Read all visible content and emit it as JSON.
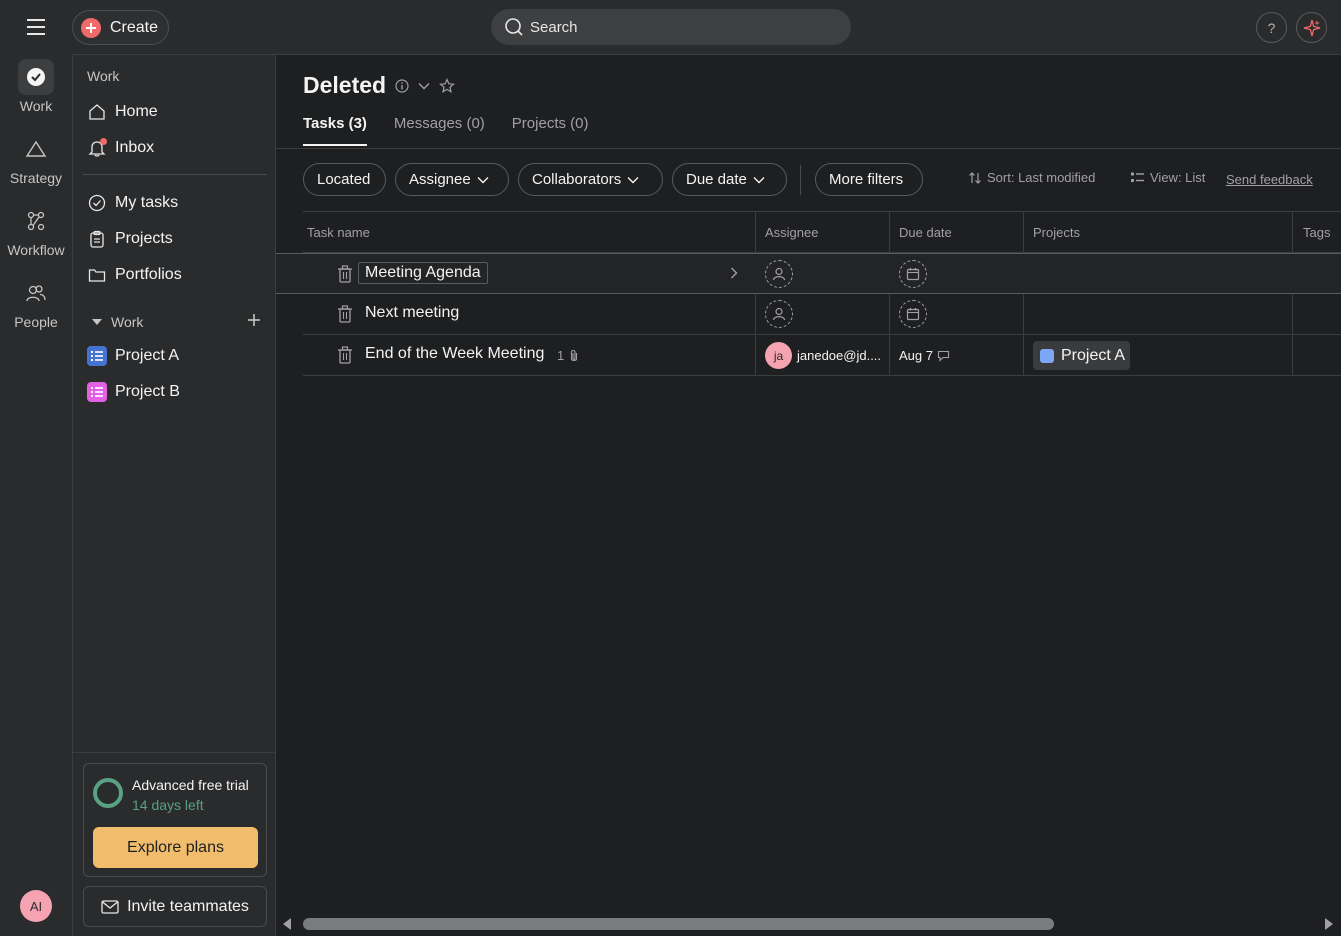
{
  "topbar": {
    "create_label": "Create",
    "search_label": "Search",
    "help_label": "?"
  },
  "rail": {
    "items": [
      {
        "label": "Work",
        "icon": "check-circle-icon",
        "active": true
      },
      {
        "label": "Strategy",
        "icon": "triangle-icon",
        "active": false
      },
      {
        "label": "Workflow",
        "icon": "workflow-icon",
        "active": false
      },
      {
        "label": "People",
        "icon": "people-icon",
        "active": false
      }
    ],
    "avatar_initials": "AI"
  },
  "sidebar": {
    "heading": "Work",
    "nav": [
      {
        "label": "Home",
        "icon": "home-icon"
      },
      {
        "label": "Inbox",
        "icon": "bell-icon",
        "has_notification": true
      }
    ],
    "nav2": [
      {
        "label": "My tasks",
        "icon": "check-circle-icon"
      },
      {
        "label": "Projects",
        "icon": "clipboard-icon"
      },
      {
        "label": "Portfolios",
        "icon": "folder-icon"
      }
    ],
    "section_label": "Work",
    "projects": [
      {
        "label": "Project A",
        "color": "#4573d2"
      },
      {
        "label": "Project B",
        "color": "#e362e3"
      }
    ],
    "trial": {
      "title": "Advanced free trial",
      "subtitle": "14 days left",
      "button": "Explore plans"
    },
    "invite_label": "Invite teammates"
  },
  "main": {
    "title": "Deleted",
    "tabs": [
      {
        "label": "Tasks (3)",
        "active": true
      },
      {
        "label": "Messages (0)",
        "active": false
      },
      {
        "label": "Projects (0)",
        "active": false
      }
    ],
    "filters": {
      "located": "Located",
      "assignee": "Assignee",
      "collaborators": "Collaborators",
      "due_date": "Due date",
      "more": "More filters",
      "sort": "Sort: Last modified",
      "view": "View: List",
      "feedback": "Send feedback"
    },
    "columns": {
      "task_name": "Task name",
      "assignee": "Assignee",
      "due_date": "Due date",
      "projects": "Projects",
      "tags": "Tags"
    },
    "rows": [
      {
        "name": "Meeting Agenda",
        "selected": true
      },
      {
        "name": "Next meeting",
        "selected": false
      },
      {
        "name": "End of the Week Meeting",
        "attachments": "1",
        "assignee_initials": "ja",
        "assignee": "janedoe@jd....",
        "due": "Aug 7",
        "project": "Project A"
      }
    ]
  },
  "colors": {
    "accent_red": "#f06a6a",
    "trial_green": "#58a182",
    "explore_button": "#f1bd6c",
    "project_a_chip": "#7ea6f7"
  }
}
